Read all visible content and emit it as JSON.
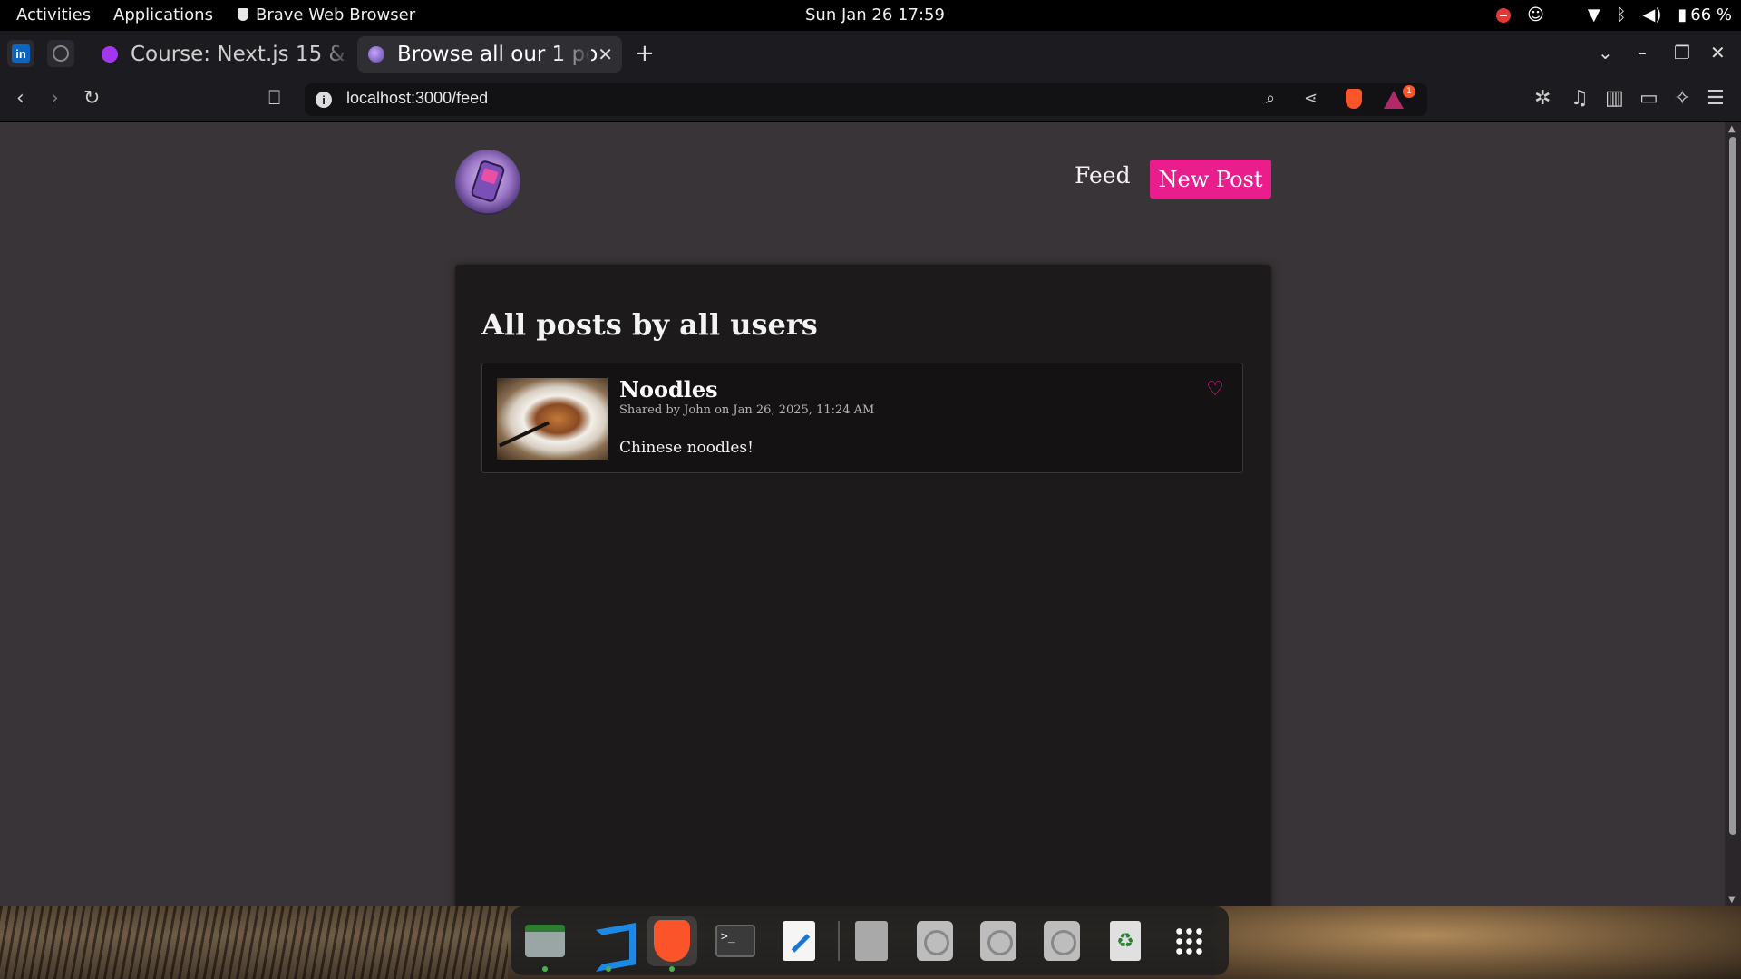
{
  "system_bar": {
    "activities": "Activities",
    "applications": "Applications",
    "active_app": "Brave Web Browser",
    "datetime": "Sun Jan 26  17:59",
    "battery": "66 %"
  },
  "browser": {
    "tabs": [
      {
        "title": "Course: Next.js 15 & R",
        "favicon": "udemy-icon"
      },
      {
        "title": "Browse all our 1 po",
        "favicon": "app-logo-icon",
        "active": true
      }
    ],
    "new_tab": "+",
    "url": "localhost:3000/feed",
    "shields_badge": "1"
  },
  "site": {
    "nav": {
      "feed": "Feed",
      "new_post": "New Post"
    },
    "heading": "All posts by all users",
    "posts": [
      {
        "title": "Noodles",
        "meta": "Shared by John on Jan 26, 2025, 11:24 AM",
        "content": "Chinese noodles!",
        "liked": false
      }
    ]
  },
  "colors": {
    "accent": "#e91e8c",
    "page_bg": "#393437",
    "panel_bg": "#1c1a1b"
  },
  "dock": {
    "apps": [
      "files-icon",
      "vscode-icon",
      "brave-icon",
      "terminal-icon",
      "text-editor-icon",
      "document-icon",
      "disc-icon",
      "disc-icon",
      "disc-icon",
      "trash-icon",
      "app-grid-icon"
    ]
  }
}
